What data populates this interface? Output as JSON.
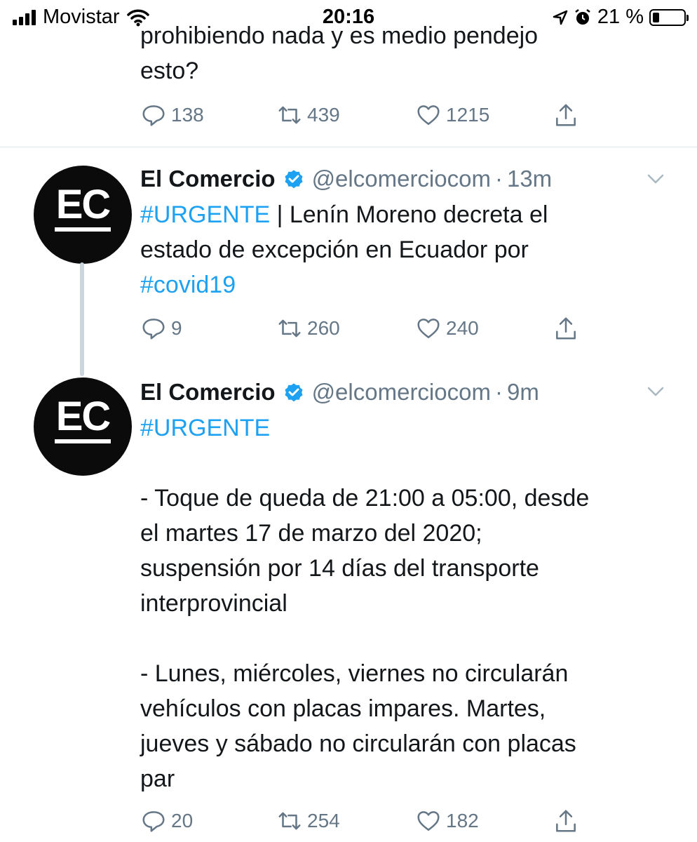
{
  "status_bar": {
    "carrier": "Movistar",
    "time": "20:16",
    "battery_percent": "21 %",
    "battery_level": 0.21
  },
  "previous_tweet": {
    "text_line1": "prohibiendo nada y es medio pendejo",
    "text_line2": "esto?",
    "replies": "138",
    "retweets": "439",
    "likes": "1215"
  },
  "tweets": [
    {
      "name": "El Comercio",
      "handle": "@elcomerciocom",
      "separator": "·",
      "time": "13m",
      "avatar_text": "EC",
      "hashtag": "#URGENTE",
      "text_after_hashtag": " | Lenín Moreno decreta el",
      "line2": "estado de excepción en Ecuador por",
      "hashtag2": "#covid19",
      "replies": "9",
      "retweets": "260",
      "likes": "240"
    },
    {
      "name": "El Comercio",
      "handle": "@elcomerciocom",
      "separator": "·",
      "time": "9m",
      "avatar_text": "EC",
      "hashtag": "#URGENTE",
      "p1_line1": "- Toque de queda de 21:00 a 05:00, desde",
      "p1_line2": "el martes 17 de marzo del 2020;",
      "p1_line3": "suspensión por 14 días del transporte",
      "p1_line4": "interprovincial",
      "p2_line1": "- Lunes, miércoles, viernes no circularán",
      "p2_line2": "vehículos con placas impares. Martes,",
      "p2_line3": "jueves y sábado no circularán con placas",
      "p2_line4": "par",
      "replies": "20",
      "retweets": "254",
      "likes": "182"
    }
  ],
  "colors": {
    "link": "#1da1f2",
    "muted": "#657786",
    "divider": "#e1e8ed",
    "thread_line": "#ccd6dd",
    "avatar_bg": "#0b0b0b"
  },
  "icons": [
    "signal-icon",
    "wifi-icon",
    "location-arrow-icon",
    "alarm-icon",
    "battery-icon",
    "reply-icon",
    "retweet-icon",
    "like-icon",
    "share-icon",
    "verified-icon",
    "chevron-down-icon"
  ]
}
